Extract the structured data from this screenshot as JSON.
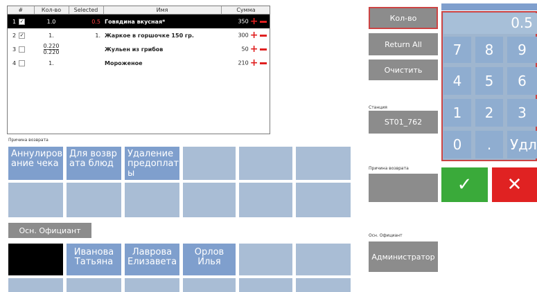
{
  "table": {
    "headers": [
      "#",
      "Кол-во",
      "Selected",
      "Имя",
      "Сумма"
    ],
    "rows": [
      {
        "num": "1",
        "checked": true,
        "qty": "1.0",
        "selected": "0.5",
        "name": "Говядина вкусная*",
        "sum": "350"
      },
      {
        "num": "2",
        "checked": true,
        "qty": "1.",
        "selected": "1.",
        "name": "Жаркое в горшочке 150 гр.",
        "sum": "300"
      },
      {
        "num": "3",
        "checked": false,
        "qty_num": "0.220",
        "qty_den": "0.220",
        "selected": "",
        "name": "Жульен из грибов",
        "sum": "50"
      },
      {
        "num": "4",
        "checked": false,
        "qty": "1.",
        "selected": "",
        "name": "Мороженое",
        "sum": "210"
      }
    ]
  },
  "return_reason_label": "Причина возврата",
  "reasons": [
    "Аннулиров ание чека",
    "Для возвр ата блюд",
    "Удаление предоплат ы"
  ],
  "waiter_button": "Осн. Официант",
  "waiters": [
    "Иванова Татьяна",
    "Лаврова Елизавета",
    "Орлов Илья"
  ],
  "side": {
    "qty_button": "Кол-во",
    "return_all_button": "Return All",
    "clear_button": "Очистить",
    "station_label": "Станция",
    "station_value": "ST01_762",
    "return_reason_label": "Причина возврата",
    "waiter_label": "Осн. Официант",
    "waiter_value": "Администратор"
  },
  "keypad": {
    "display": "0.5",
    "keys": [
      "7",
      "8",
      "9",
      "4",
      "5",
      "6",
      "1",
      "2",
      "3",
      "0",
      ".",
      "Удл"
    ],
    "ok": "✓",
    "cancel": "✕"
  },
  "colors": {
    "tile_blue": "#7f9fcd",
    "tile_light": "#a9bdd5",
    "ok_green": "#3aaa3a",
    "cancel_red": "#e02222"
  }
}
